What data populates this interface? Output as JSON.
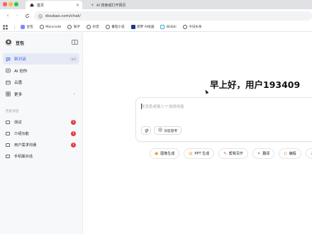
{
  "browser": {
    "tabs": [
      {
        "label": "首页",
        "active": true
      },
      {
        "label": "AI 搜索或打开网页",
        "active": false
      }
    ],
    "address": "doubao.com/chat/",
    "bookmarks": [
      {
        "label": "豆包",
        "icon": "doubao-icon"
      },
      {
        "label": "Marscode",
        "icon": "globe-icon"
      },
      {
        "label": "知乎",
        "icon": "globe-icon"
      },
      {
        "label": "抖音",
        "icon": "globe-icon"
      },
      {
        "label": "番茄小说",
        "icon": "globe-icon"
      },
      {
        "label": "即梦 AI绘画",
        "icon": "jimeng-icon"
      },
      {
        "label": "Bilibili",
        "icon": "bilibili-icon"
      },
      {
        "label": "今日头条",
        "icon": "globe-icon"
      }
    ]
  },
  "sidebar": {
    "brand": "豆包",
    "menu": [
      {
        "label": "新对话",
        "icon": "new-chat-icon",
        "shortcut": "⌘K",
        "active": true
      },
      {
        "label": "AI 创作",
        "icon": "ai-create-icon"
      },
      {
        "label": "云盘",
        "icon": "cloud-drive-icon"
      },
      {
        "label": "更多",
        "icon": "more-grid-icon",
        "chevron": "›"
      }
    ],
    "history_label": "历史对话",
    "history": [
      {
        "label": "测试",
        "badge": "1"
      },
      {
        "label": "介绍功能",
        "badge": "1"
      },
      {
        "label": "用户需求沟通",
        "badge": "1"
      },
      {
        "label": "手机版对话"
      }
    ]
  },
  "main": {
    "greeting": "早上好，用户193409",
    "composer": {
      "placeholder": "发消息或输入\"/\"选择技能",
      "deep_think": "深度思考"
    },
    "skills": [
      {
        "label": "图像生成",
        "icon": "image-gen-icon",
        "color": "#f08a24"
      },
      {
        "label": "PPT 生成",
        "icon": "ppt-icon",
        "color": "#f0a020"
      },
      {
        "label": "帮我写作",
        "icon": "writing-icon",
        "color": "#d9478a"
      },
      {
        "label": "翻译",
        "icon": "translate-icon",
        "color": "#2aa876"
      },
      {
        "label": "编程",
        "icon": "code-icon",
        "color": "#e07b39"
      },
      {
        "label": "",
        "icon": "music-icon",
        "color": "#7a5af5"
      }
    ]
  },
  "colors": {
    "accent": "#2e5ce6",
    "badge": "#e5393e",
    "active_bg": "#e7eaf4"
  }
}
